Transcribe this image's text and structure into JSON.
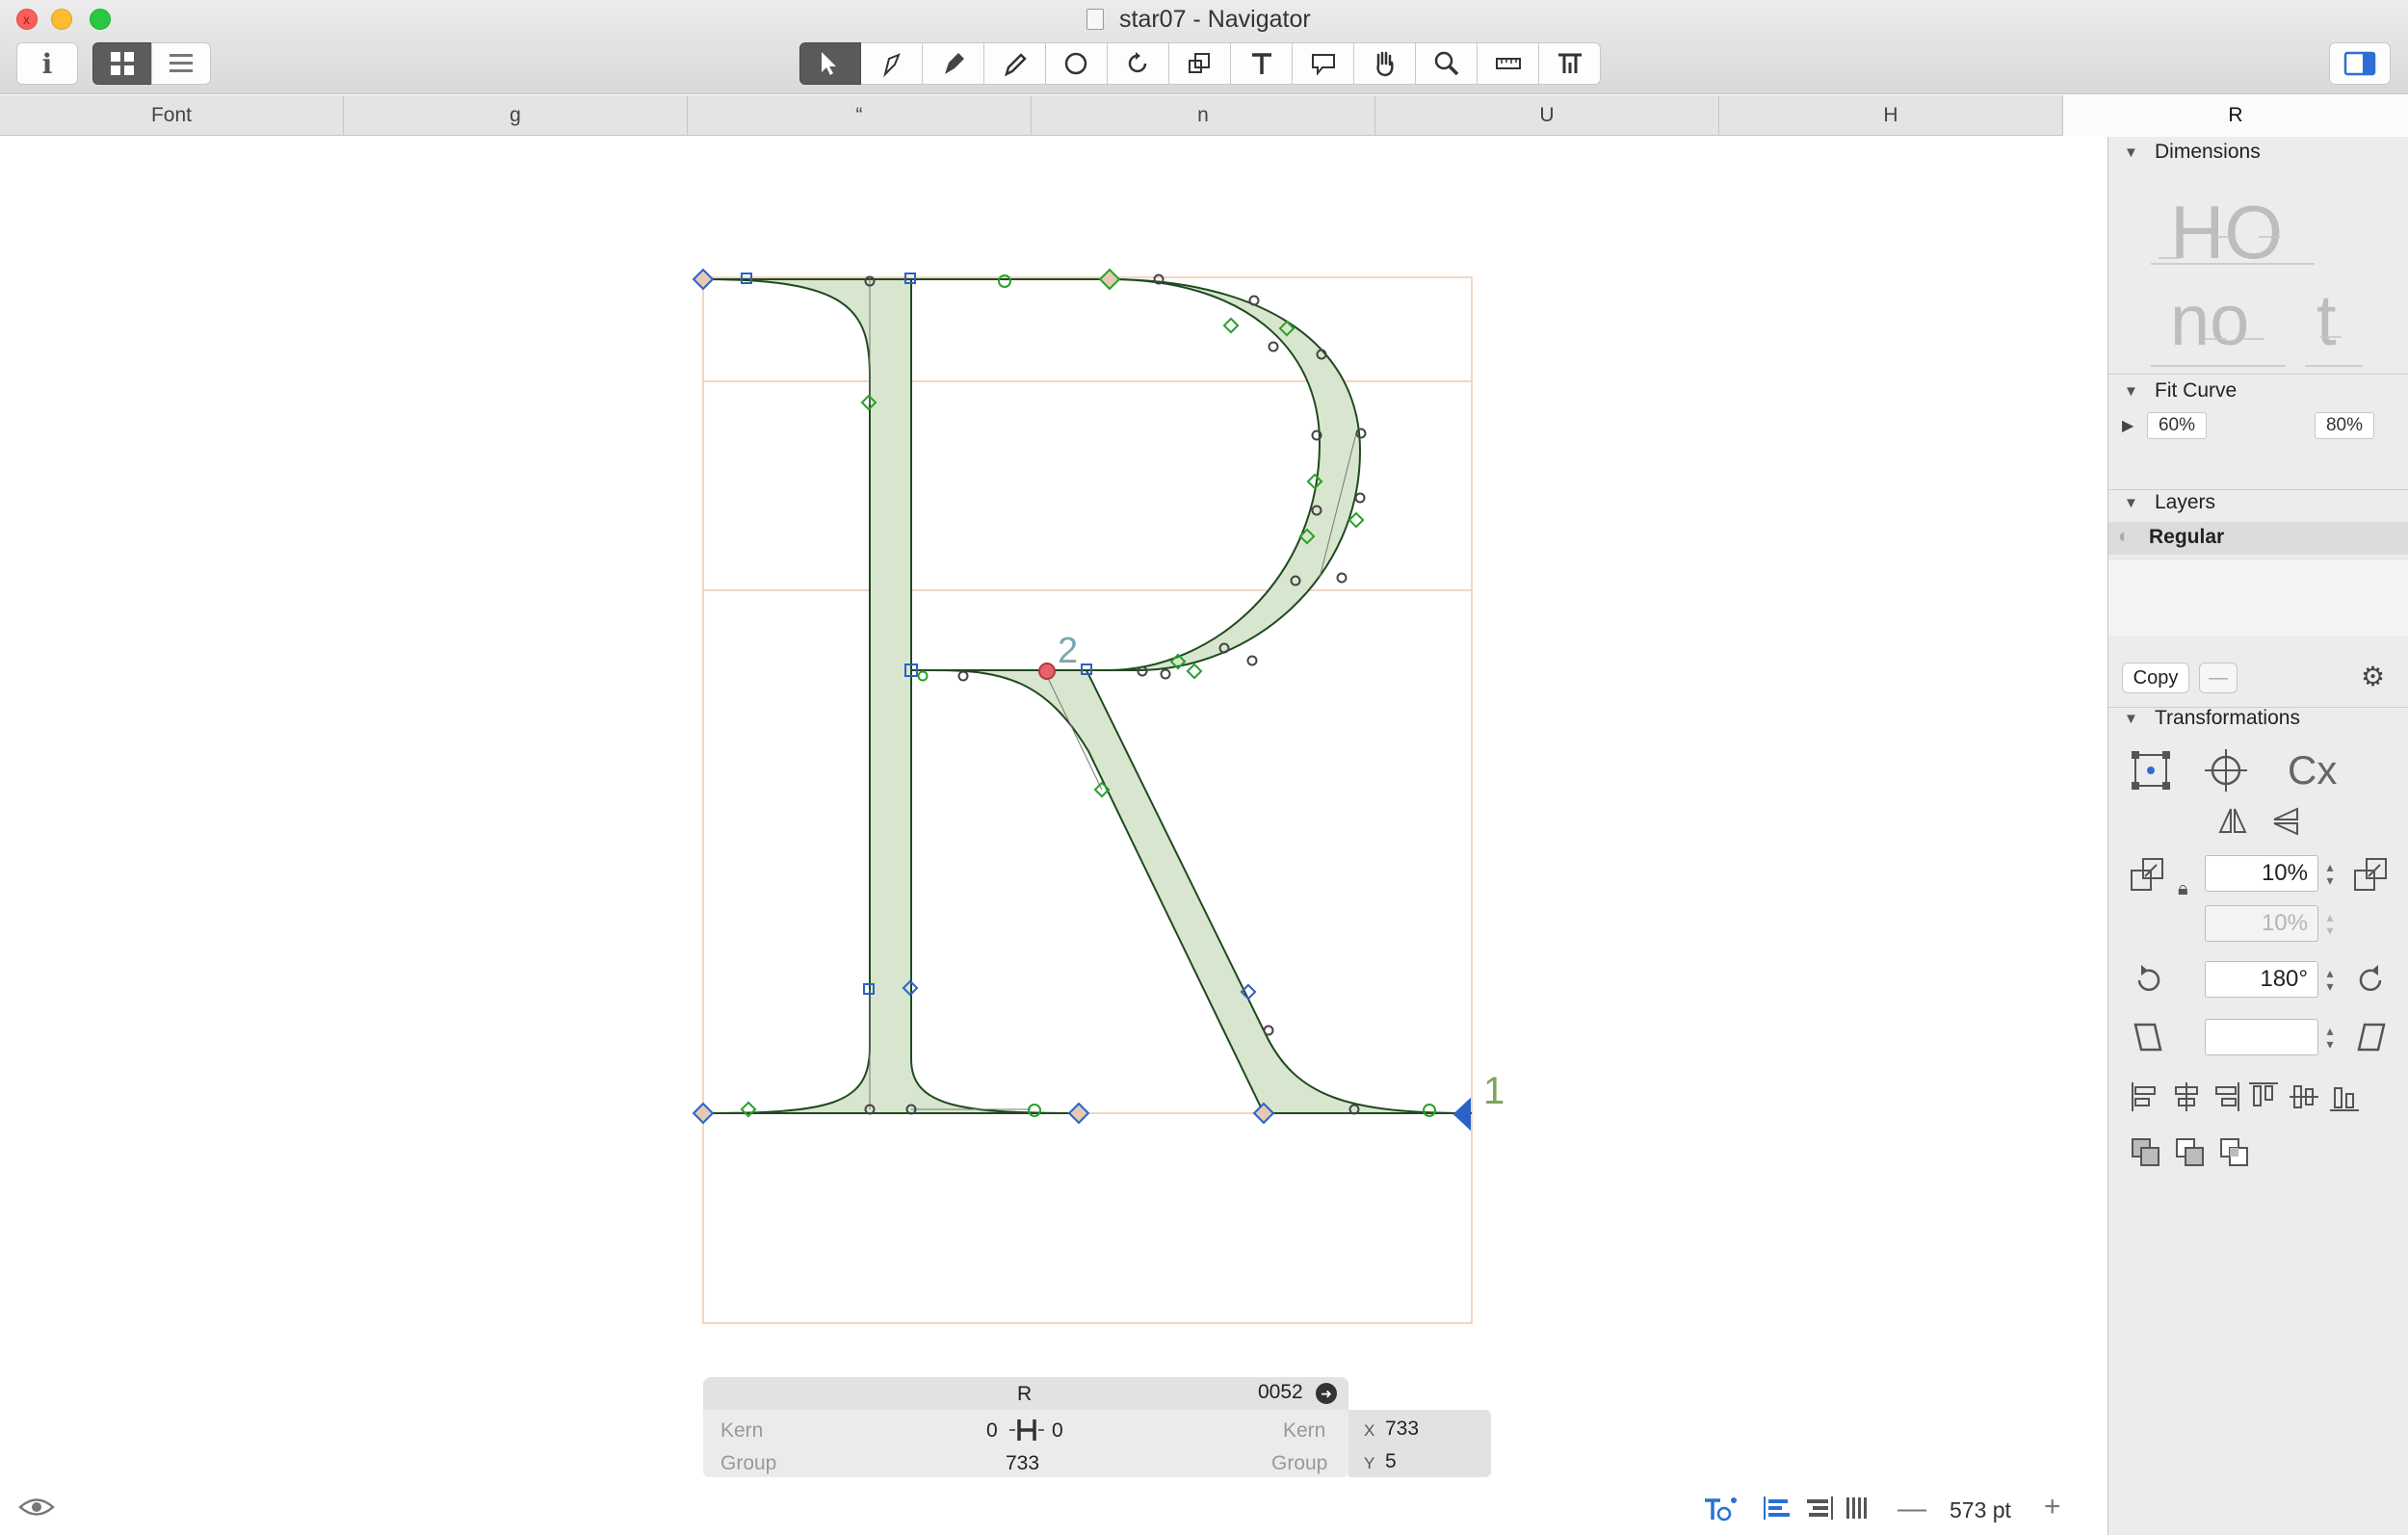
{
  "window": {
    "title": "star07 - Navigator",
    "close_glyph": "x",
    "icons": [
      "close-icon",
      "minimize-icon",
      "maximize-icon",
      "document-icon"
    ]
  },
  "toolbar": {
    "info_label": "i",
    "tools": [
      "select-tool",
      "edit-tool",
      "pen-tool",
      "pencil-tool",
      "shape-tool",
      "rotate-tool",
      "scale-tool",
      "text-tool",
      "annotation-tool",
      "hand-tool",
      "zoom-tool",
      "measure-tool",
      "type-tool"
    ],
    "active_tool": "select-tool"
  },
  "tabs": [
    "Font",
    "g",
    "“",
    "n",
    "U",
    "H",
    "R"
  ],
  "active_tab": "R",
  "canvas": {
    "node_labels": {
      "first": "1",
      "second": "2"
    }
  },
  "glyph_info": {
    "name": "R",
    "unicode": "0052",
    "left_kern_label": "Kern",
    "left_group_label": "Group",
    "right_kern_label": "Kern",
    "right_group_label": "Group",
    "left_sidebearing": "0",
    "right_sidebearing": "0",
    "width": "733",
    "x_label": "X",
    "x_value": "733",
    "y_label": "Y",
    "y_value": "5"
  },
  "statusbar": {
    "zoom": "573 pt",
    "minus": "—",
    "plus": "+"
  },
  "inspector": {
    "dimensions_title": "Dimensions",
    "dimension_preview": [
      "HO",
      "no",
      "t"
    ],
    "fit_curve_title": "Fit Curve",
    "fit_min": "60%",
    "fit_max": "80%",
    "layers_title": "Layers",
    "layer_name": "Regular",
    "copy_label": "Copy",
    "minus_label": "—",
    "transformations_title": "Transformations",
    "transform_text": "Cx",
    "scale_x": "10%",
    "scale_y": "10%",
    "rotate": "180°",
    "slant": ""
  },
  "colors": {
    "glyph_fill": "#d9e6cf",
    "outline": "#1f4a1f",
    "guide": "#f0c8ae",
    "node_green": "#2aa02a",
    "node_blue": "#2a62c8",
    "label_number": "#7aa7b0",
    "accent": "#2b6fd6"
  }
}
